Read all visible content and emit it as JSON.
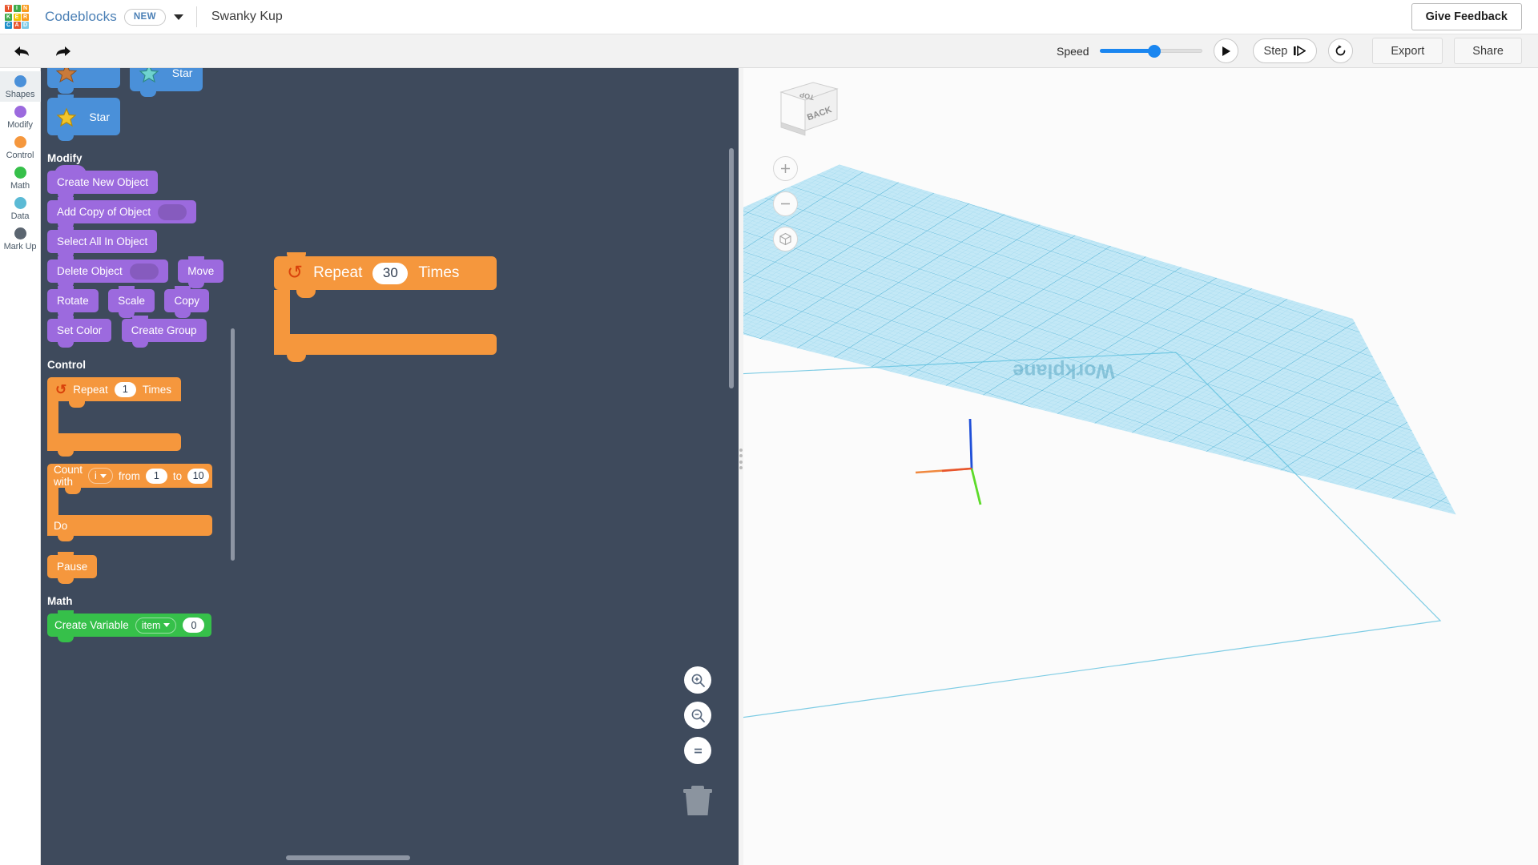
{
  "topbar": {
    "logo_letters": [
      "T",
      "I",
      "N",
      "K",
      "E",
      "R",
      "C",
      "A",
      "D"
    ],
    "logo_colors": [
      "#e8552d",
      "#3fab4a",
      "#f99b1c",
      "#3fab4a",
      "#f1c500",
      "#f99b1c",
      "#1d8fc9",
      "#e8552d",
      "#7ccbe8"
    ],
    "app_name": "Codeblocks",
    "new_badge": "NEW",
    "document_title": "Swanky Kup",
    "feedback_label": "Give Feedback"
  },
  "toolbar": {
    "undo_icon": "undo-arrow-icon",
    "redo_icon": "redo-arrow-icon",
    "speed_label": "Speed",
    "speed_value": 53,
    "play_label": "play-icon",
    "step_label": "Step",
    "restart_label": "restart-icon",
    "export_label": "Export",
    "share_label": "Share"
  },
  "rail": {
    "items": [
      {
        "label": "Shapes",
        "color": "#4a90d9",
        "active": true
      },
      {
        "label": "Modify",
        "color": "#9c6ade",
        "active": false
      },
      {
        "label": "Control",
        "color": "#f5973d",
        "active": false
      },
      {
        "label": "Math",
        "color": "#36c04a",
        "active": false
      },
      {
        "label": "Data",
        "color": "#5bbad5",
        "active": false
      },
      {
        "label": "Mark Up",
        "color": "#5b6570",
        "active": false
      }
    ]
  },
  "palette": {
    "shapes_blocks": [
      {
        "label": "",
        "icon": "shape-icon-partial"
      },
      {
        "label": "Star",
        "icon": "star-teal-icon"
      },
      {
        "label": "Star",
        "icon": "star-yellow-icon"
      }
    ],
    "modify_header": "Modify",
    "modify_blocks": [
      {
        "label": "Create New Object",
        "has_slot": false,
        "hat": true
      },
      {
        "label": "Add Copy of Object",
        "has_slot": true,
        "hat": false
      },
      {
        "label": "Select All In Object",
        "has_slot": false,
        "hat": false
      },
      {
        "label": "Delete Object",
        "has_slot": true,
        "hat": false
      },
      {
        "label": "Move",
        "has_slot": false,
        "hat": false
      },
      {
        "label": "Rotate",
        "has_slot": false,
        "hat": false
      },
      {
        "label": "Scale",
        "has_slot": false,
        "hat": false
      },
      {
        "label": "Copy",
        "has_slot": false,
        "hat": false
      },
      {
        "label": "Set Color",
        "has_slot": false,
        "hat": false
      },
      {
        "label": "Create Group",
        "has_slot": false,
        "hat": false
      }
    ],
    "control_header": "Control",
    "control_repeat": {
      "prefix": "Repeat",
      "value": "1",
      "suffix": "Times"
    },
    "control_count": {
      "prefix": "Count with",
      "variable": "i",
      "from_label": "from",
      "from_value": "1",
      "to_label": "to",
      "to_value": "10",
      "do_label": "Do"
    },
    "control_pause": {
      "label": "Pause"
    },
    "math_header": "Math",
    "math_create_variable": {
      "label": "Create Variable",
      "variable": "item",
      "value": "0"
    }
  },
  "workspace": {
    "repeat_block": {
      "prefix": "Repeat",
      "value": "30",
      "suffix": "Times",
      "icon": "loop-icon"
    },
    "tools": [
      {
        "name": "zoom-in-icon"
      },
      {
        "name": "zoom-out-icon"
      },
      {
        "name": "zoom-fit-icon"
      },
      {
        "name": "trash-icon"
      }
    ]
  },
  "viewport": {
    "viewcube": {
      "top_face": "TOP",
      "front_face": "BACK"
    },
    "controls": [
      {
        "name": "zoom-in-button",
        "glyph": "+"
      },
      {
        "name": "zoom-out-button",
        "glyph": "−"
      },
      {
        "name": "fit-all-button",
        "glyph": "cube-icon"
      }
    ],
    "workplane_label": "Workplane",
    "grid_color": "#a5dcf0",
    "axis_colors": {
      "x": "#e8552d",
      "y": "#5ddb2a",
      "z": "#1f4fd8"
    }
  }
}
